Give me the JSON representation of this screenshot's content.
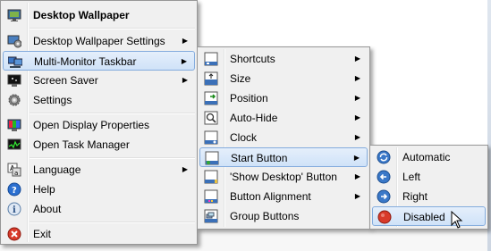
{
  "main_menu": {
    "items": [
      {
        "label": "Desktop Wallpaper",
        "icon": "wallpaper-monitor-icon",
        "bold": true
      },
      {
        "label": "Desktop Wallpaper Settings",
        "icon": "wallpaper-settings-icon",
        "submenu": true
      },
      {
        "label": "Multi-Monitor Taskbar",
        "icon": "multi-monitor-icon",
        "submenu": true,
        "highlighted": true
      },
      {
        "label": "Screen Saver",
        "icon": "screen-saver-icon",
        "submenu": true
      },
      {
        "label": "Settings",
        "icon": "gear-icon"
      },
      {
        "label": "Open Display Properties",
        "icon": "display-properties-icon"
      },
      {
        "label": "Open Task Manager",
        "icon": "task-manager-icon"
      },
      {
        "label": "Language",
        "icon": "language-icon",
        "submenu": true
      },
      {
        "label": "Help",
        "icon": "help-icon"
      },
      {
        "label": "About",
        "icon": "info-icon"
      },
      {
        "label": "Exit",
        "icon": "exit-icon"
      }
    ]
  },
  "taskbar_menu": {
    "items": [
      {
        "label": "Shortcuts",
        "icon": "shortcuts-icon",
        "submenu": true
      },
      {
        "label": "Size",
        "icon": "size-icon",
        "submenu": true
      },
      {
        "label": "Position",
        "icon": "position-icon",
        "submenu": true
      },
      {
        "label": "Auto-Hide",
        "icon": "auto-hide-icon",
        "submenu": true
      },
      {
        "label": "Clock",
        "icon": "clock-icon",
        "submenu": true
      },
      {
        "label": "Start Button",
        "icon": "start-button-icon",
        "submenu": true,
        "highlighted": true
      },
      {
        "label": "'Show Desktop' Button",
        "icon": "show-desktop-icon",
        "submenu": true
      },
      {
        "label": "Button Alignment",
        "icon": "button-alignment-icon",
        "submenu": true
      },
      {
        "label": "Group Buttons",
        "icon": "group-buttons-icon"
      }
    ]
  },
  "start_button_menu": {
    "items": [
      {
        "label": "Automatic",
        "icon": "automatic-icon"
      },
      {
        "label": "Left",
        "icon": "left-arrow-icon"
      },
      {
        "label": "Right",
        "icon": "right-arrow-icon"
      },
      {
        "label": "Disabled",
        "icon": "disabled-icon",
        "highlighted": true
      }
    ]
  },
  "submenu_arrow": "▶",
  "colors": {
    "menu_bg": "#f0f0f0",
    "highlight_border": "#84acdd",
    "highlight_fill": "#d5e5f9"
  }
}
